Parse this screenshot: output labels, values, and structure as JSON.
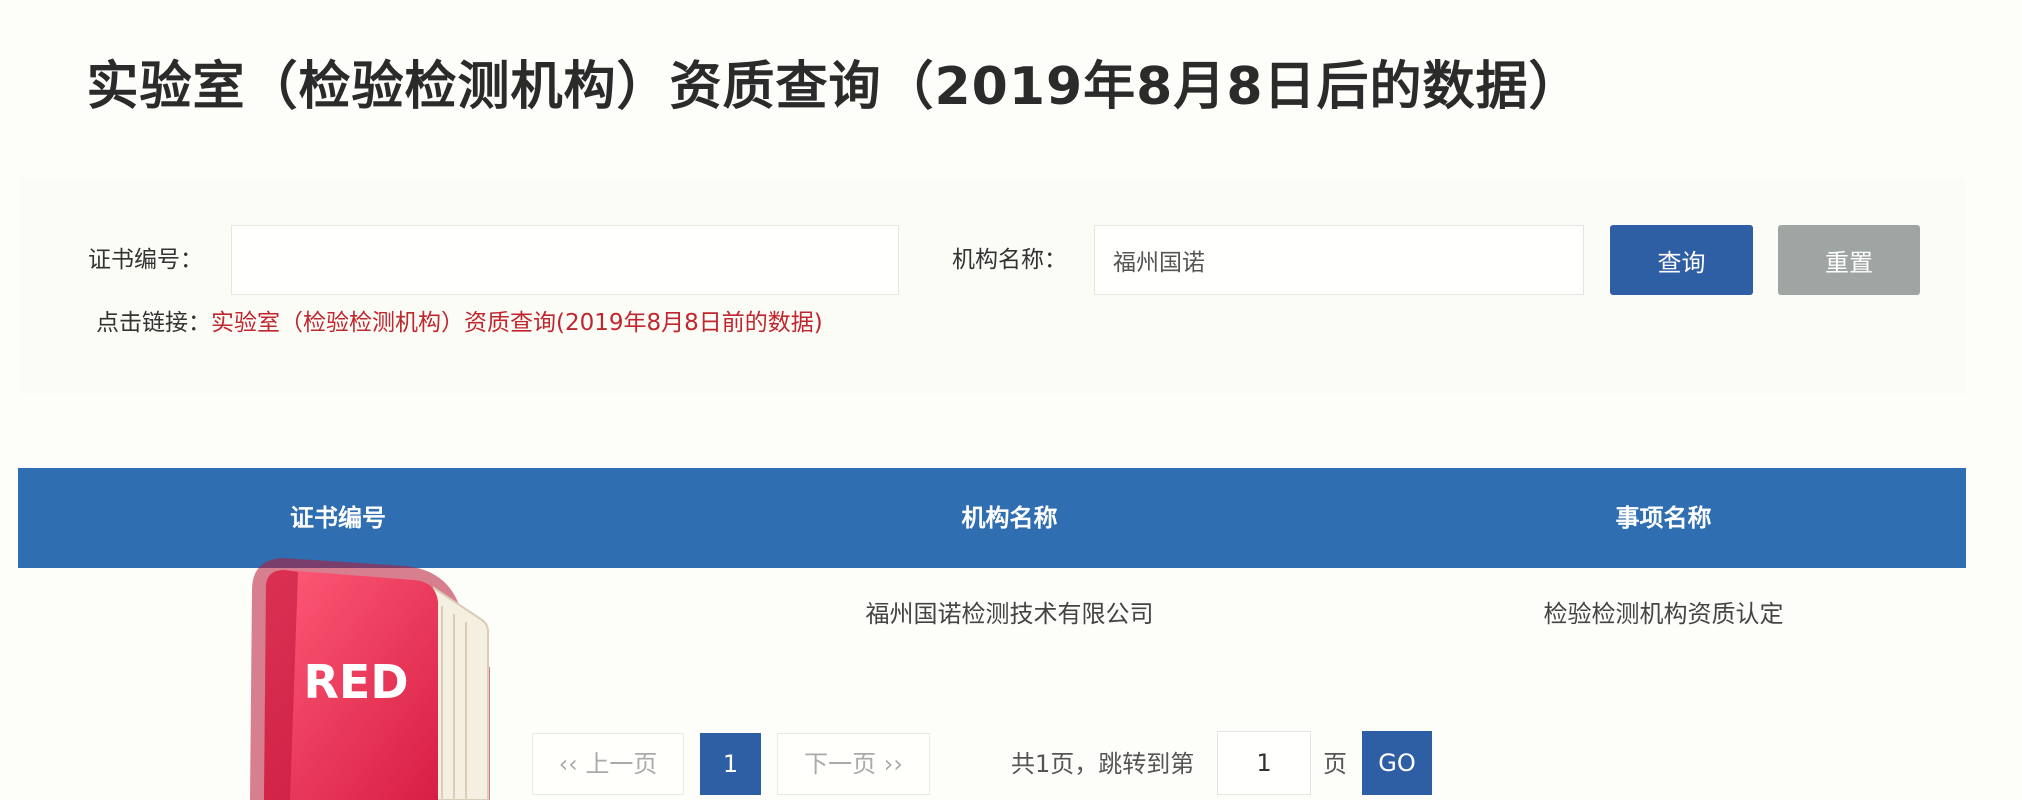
{
  "page": {
    "title": "实验室（检验检测机构）资质查询（2019年8月8日后的数据）"
  },
  "search": {
    "cert_label": "证书编号：",
    "cert_value": "",
    "org_label": "机构名称：",
    "org_value": "福州国诺",
    "query_button": "查询",
    "reset_button": "重置",
    "link_prefix": "点击链接：",
    "link_text": "实验室（检验检测机构）资质查询(2019年8月8日前的数据)"
  },
  "table": {
    "headers": [
      "证书编号",
      "机构名称",
      "事项名称"
    ],
    "rows": [
      {
        "cert_no": "",
        "org_name": "福州国诺检测技术有限公司",
        "item_name": "检验检测机构资质认定"
      }
    ]
  },
  "pagination": {
    "prev": "上一页",
    "prev_glyph": "‹‹",
    "current": "1",
    "next": "下一页",
    "next_glyph": "››",
    "total_text": "共1页，跳转到第",
    "jump_value": "1",
    "page_suffix": "页",
    "go": "GO"
  },
  "sticker": {
    "text": "RED",
    "color": "#e8324f"
  },
  "colors": {
    "primary": "#2e5ea3",
    "header": "#2f6eb0",
    "link": "#c0262f",
    "reset": "#9fa5a2"
  }
}
